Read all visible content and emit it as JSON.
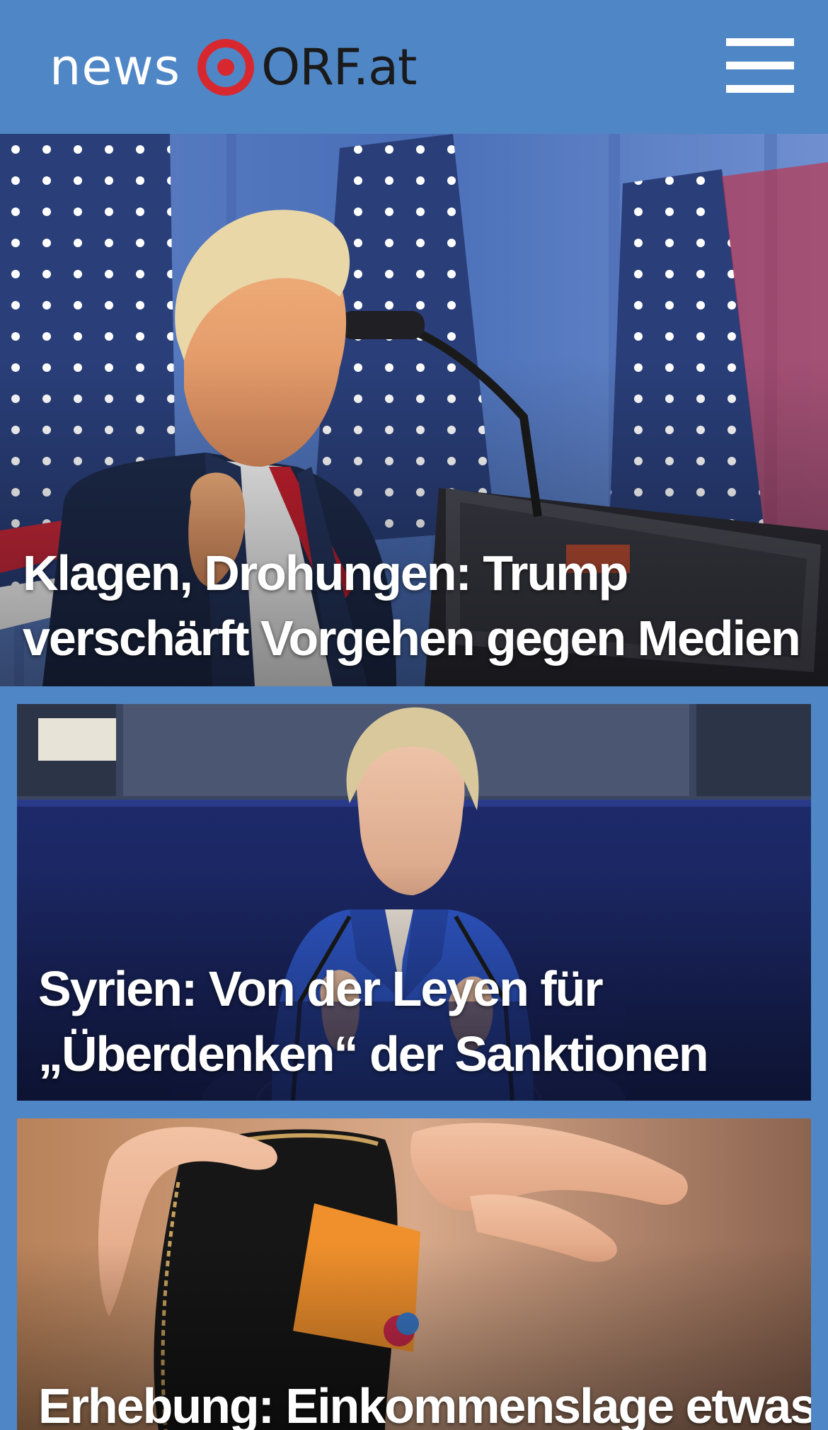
{
  "header": {
    "logo_news": "news",
    "logo_orf": "ORF.at",
    "colors": {
      "bar_background": "#4f86c6",
      "logo_red": "#d7282f",
      "logo_dark": "#1a1a1a"
    },
    "icons": {
      "logo_mark": "orf-eye-icon",
      "menu": "hamburger-menu-icon"
    }
  },
  "stories": [
    {
      "title": "Klagen, Drohungen: Trump verschärft Vorgehen gegen Medien",
      "image_subject": "photo-speaker-at-podium"
    },
    {
      "title": "Syrien: Von der Leyen für „Überdenken“ der Sanktionen",
      "image_subject": "photo-speaker-in-parliament"
    },
    {
      "title": "Erhebung: Einkommenslage etwas",
      "image_subject": "photo-wallet-with-card"
    }
  ]
}
